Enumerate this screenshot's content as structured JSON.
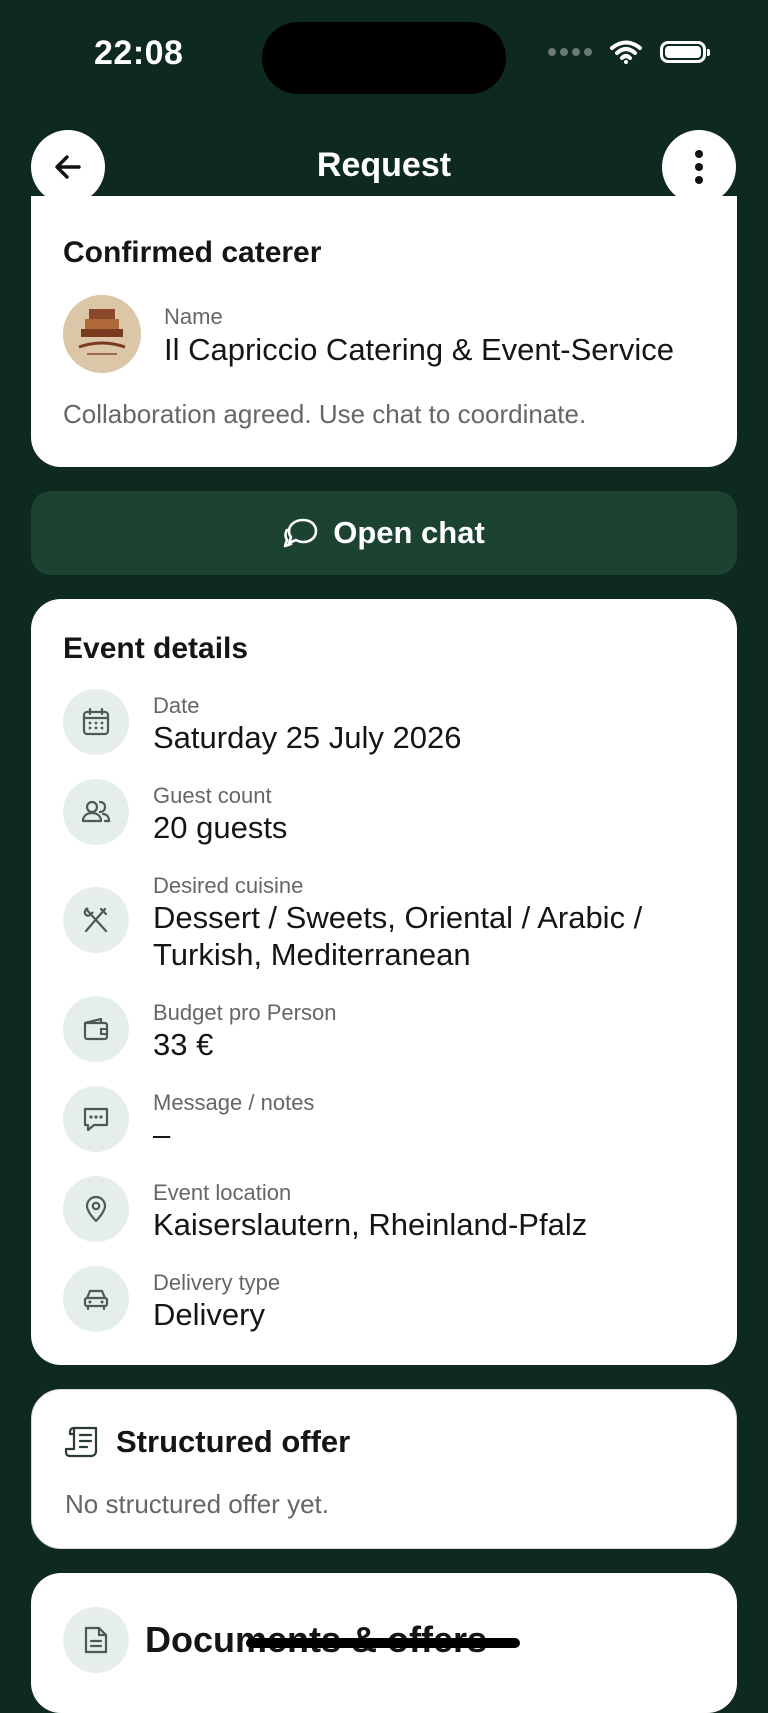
{
  "status_bar": {
    "time": "22:08"
  },
  "nav": {
    "title": "Request"
  },
  "caterer_card": {
    "title": "Confirmed caterer",
    "name_label": "Name",
    "name_value": "Il Capriccio Catering & Event-Service",
    "note": "Collaboration agreed. Use chat to coordinate."
  },
  "chat_button": {
    "label": "Open chat"
  },
  "event_details": {
    "title": "Event details",
    "items": [
      {
        "label": "Date",
        "value": "Saturday 25 July 2026",
        "icon": "calendar-icon"
      },
      {
        "label": "Guest count",
        "value": "20 guests",
        "icon": "users-icon"
      },
      {
        "label": "Desired cuisine",
        "value": "Dessert / Sweets, Oriental / Arabic / Turkish, Mediterranean",
        "icon": "cutlery-icon"
      },
      {
        "label": "Budget pro Person",
        "value": "33 €",
        "icon": "wallet-icon"
      },
      {
        "label": "Message / notes",
        "value": "–",
        "icon": "message-icon"
      },
      {
        "label": "Event location",
        "value": "Kaiserslautern, Rheinland-Pfalz",
        "icon": "location-pin-icon"
      },
      {
        "label": "Delivery type",
        "value": "Delivery",
        "icon": "car-icon"
      }
    ]
  },
  "structured_offer": {
    "title": "Structured offer",
    "note": "No structured offer yet."
  },
  "documents": {
    "title": "Documents & offers"
  },
  "colors": {
    "background": "#0e2a20",
    "accent": "#1c4331",
    "icon_bg": "#e5eeea",
    "card": "#ffffff"
  }
}
